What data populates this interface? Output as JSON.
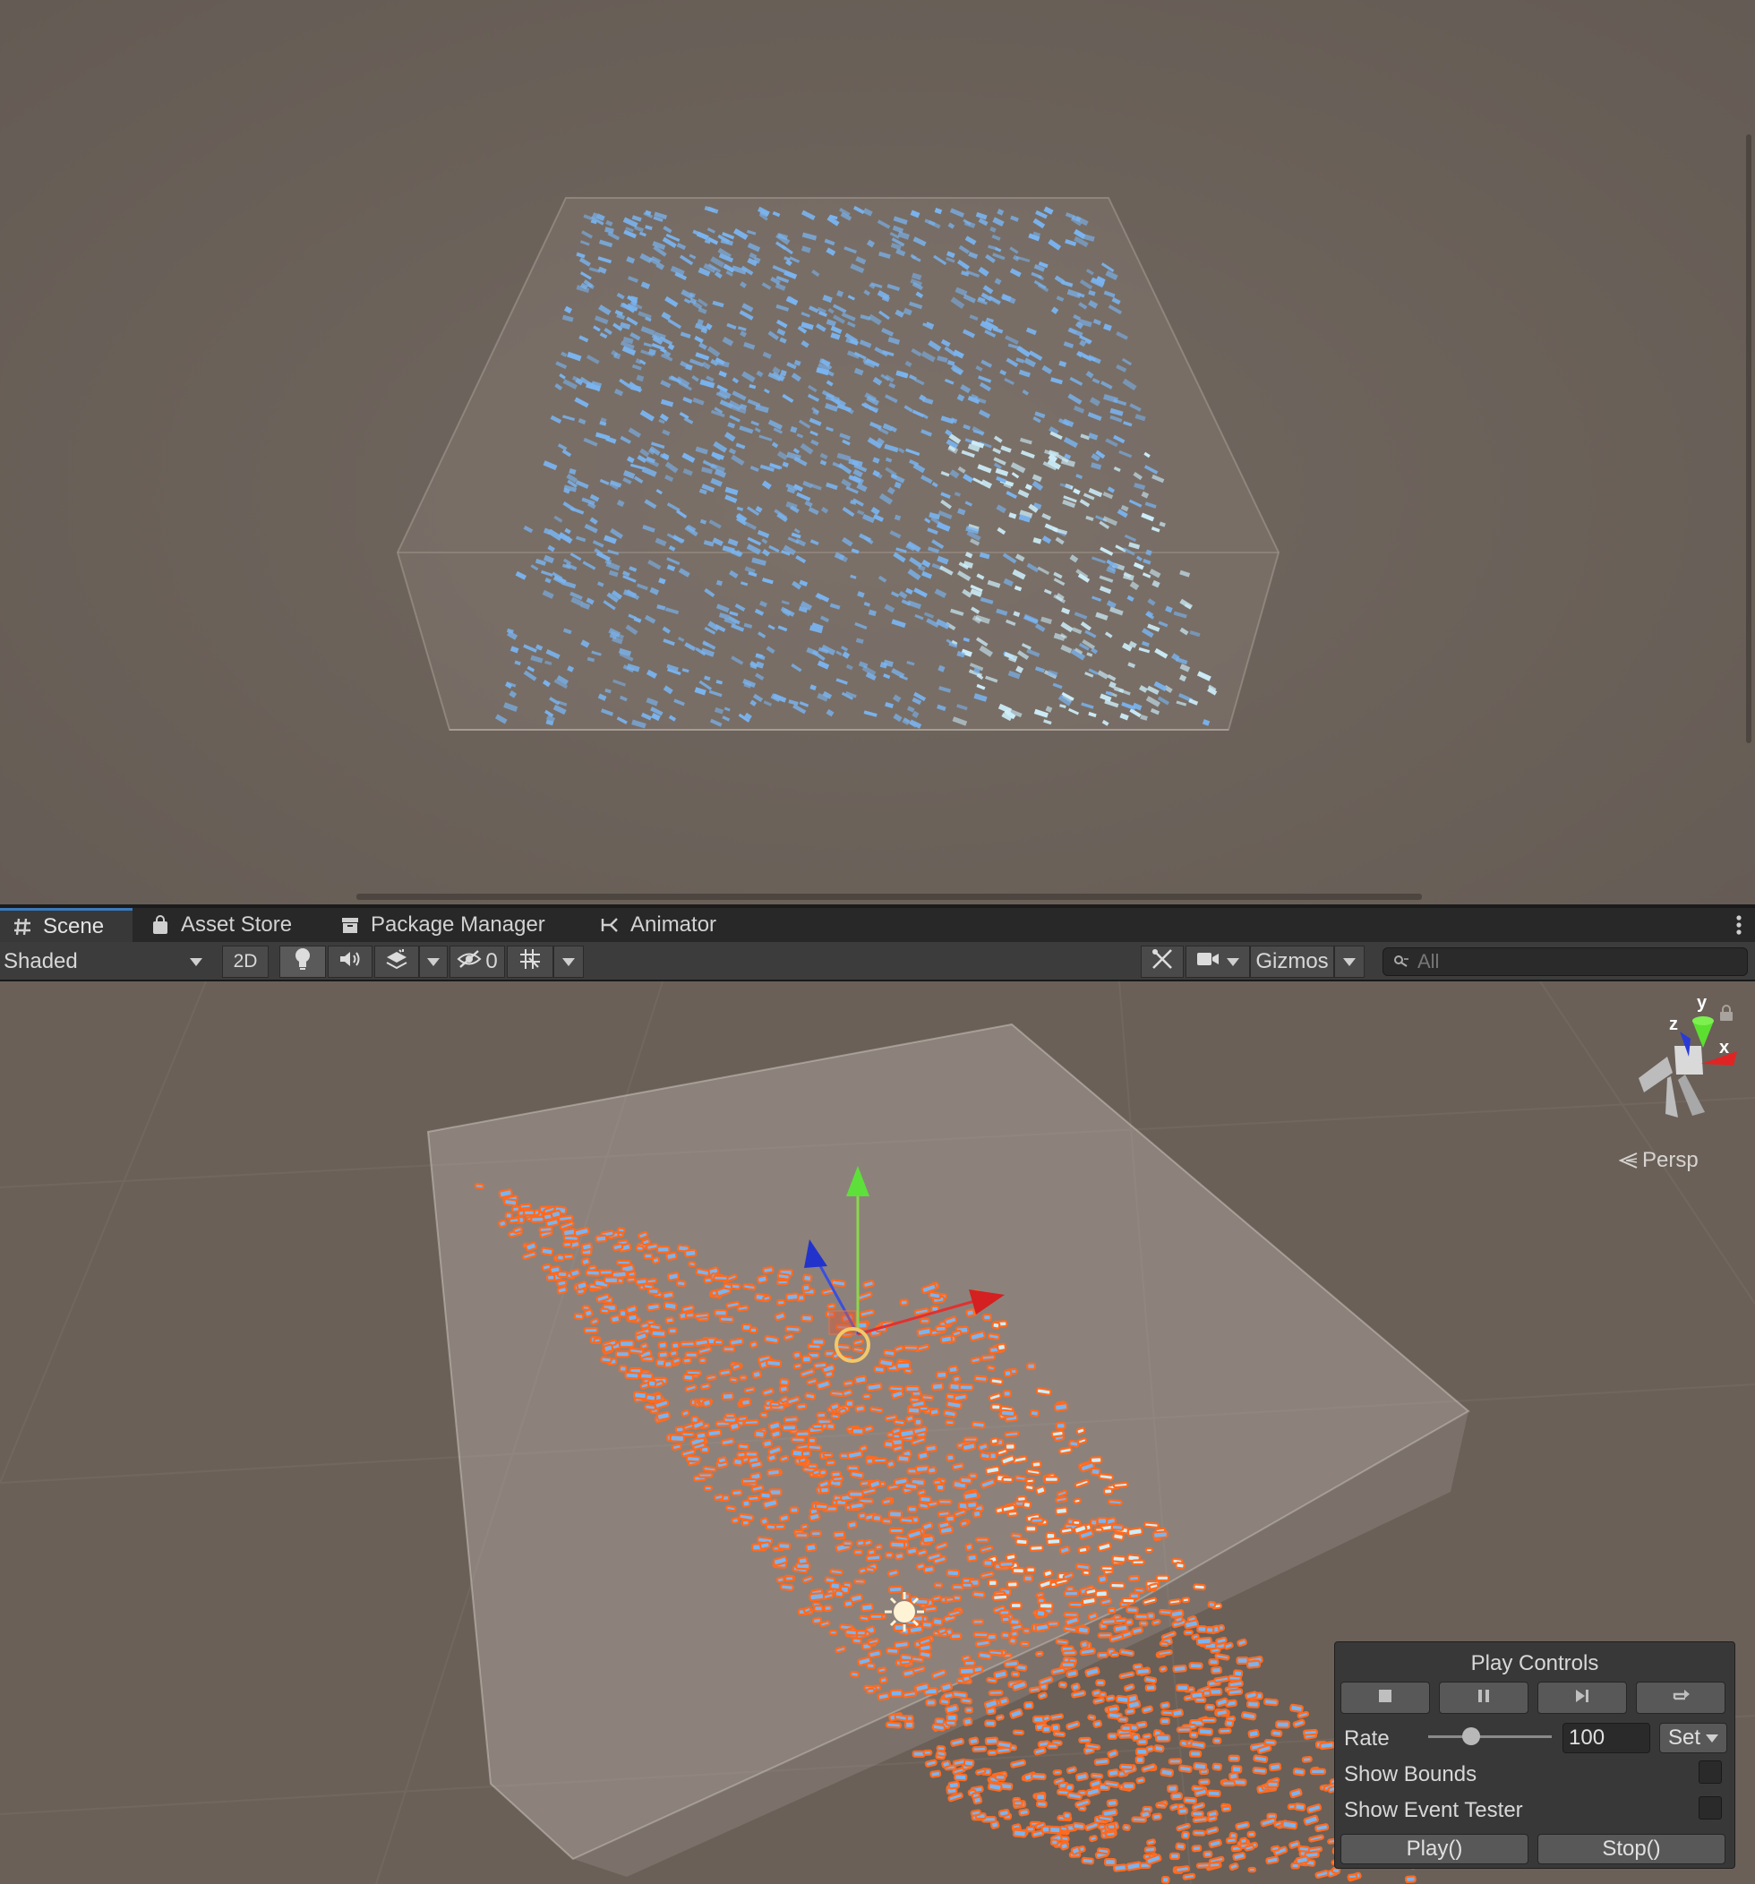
{
  "tabs": [
    {
      "label": "Scene",
      "icon": "grid-hash-icon",
      "active": true
    },
    {
      "label": "Asset Store",
      "icon": "shopping-bag-icon",
      "active": false
    },
    {
      "label": "Package Manager",
      "icon": "package-box-icon",
      "active": false
    },
    {
      "label": "Animator",
      "icon": "animator-branch-icon",
      "active": false
    }
  ],
  "toolbar": {
    "draw_mode": "Shaded",
    "mode_2d": "2D",
    "hidden_count": "0",
    "gizmos": "Gizmos",
    "search_placeholder": "All"
  },
  "scene_gizmo": {
    "axis_y": "y",
    "axis_z": "z",
    "axis_x": "x",
    "projection": "Persp"
  },
  "play_controls": {
    "title": "Play Controls",
    "rate_label": "Rate",
    "rate_value": "100",
    "rate_slider_fraction": 0.35,
    "set_label": "Set",
    "show_bounds_label": "Show Bounds",
    "show_bounds_checked": false,
    "show_event_tester_label": "Show Event Tester",
    "show_event_tester_checked": false,
    "play_label": "Play()",
    "stop_label": "Stop()"
  },
  "colors": {
    "selection_outline": "#ff6a1f",
    "particle_blue": "#7ab4f0",
    "particle_light": "#cdeefa",
    "accent_tab": "#3a79bb"
  }
}
